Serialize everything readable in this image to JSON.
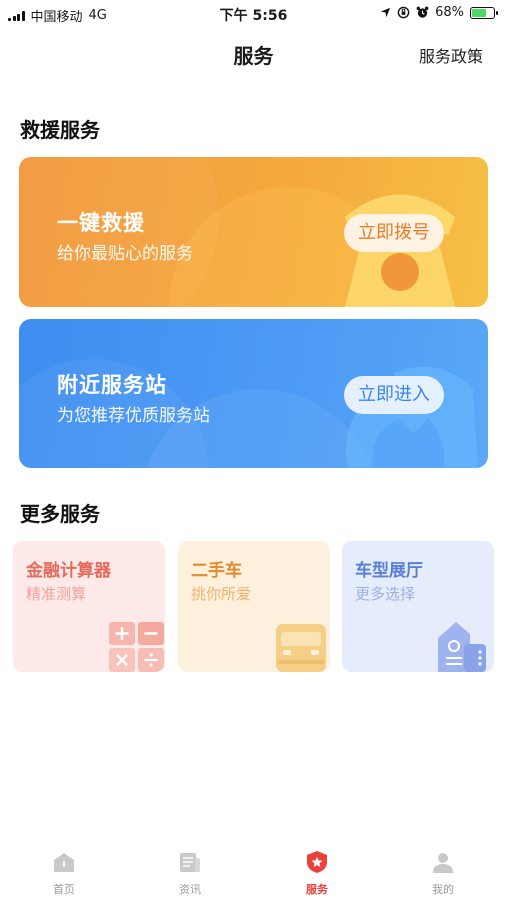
{
  "status_bar": {
    "carrier": "中国移动",
    "network": "4G",
    "time": "下午 5:56",
    "battery": "68%",
    "battery_level": 0.68
  },
  "nav": {
    "title": "服务",
    "policy_link": "服务政策"
  },
  "rescue_section": {
    "title": "救援服务",
    "cards": [
      {
        "title": "一键救援",
        "subtitle": "给你最贴心的服务",
        "button": "立即拨号",
        "icon": "telephone-icon"
      },
      {
        "title": "附近服务站",
        "subtitle": "为您推荐优质服务站",
        "button": "立即进入",
        "icon": "wrench-icon"
      }
    ]
  },
  "more_section": {
    "title": "更多服务",
    "items": [
      {
        "title": "金融计算器",
        "subtitle": "精准测算",
        "icon": "calculator-icon"
      },
      {
        "title": "二手车",
        "subtitle": "挑你所爱",
        "icon": "car-icon"
      },
      {
        "title": "车型展厅",
        "subtitle": "更多选择",
        "icon": "showroom-icon"
      }
    ]
  },
  "tab_bar": {
    "active": "服务",
    "tabs": [
      {
        "label": "首页",
        "icon": "home-icon"
      },
      {
        "label": "资讯",
        "icon": "news-icon"
      },
      {
        "label": "服务",
        "icon": "service-star-icon"
      },
      {
        "label": "我的",
        "icon": "profile-icon"
      }
    ]
  },
  "colors": {
    "accent": "#e8423a",
    "rescue_orange": "#f5a93c",
    "station_blue": "#4d9bf5"
  }
}
